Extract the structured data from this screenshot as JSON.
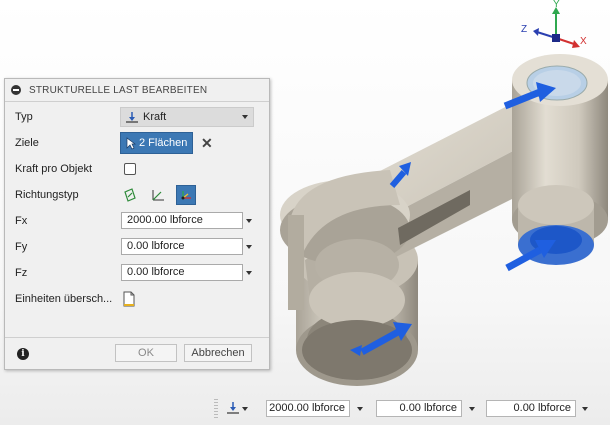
{
  "dialog": {
    "title": "STRUKTURELLE LAST BEARBEITEN",
    "typ_label": "Typ",
    "typ_value": "Kraft",
    "ziele_label": "Ziele",
    "ziele_value": "2 Flächen",
    "kraft_pro_objekt_label": "Kraft pro Objekt",
    "kraft_pro_objekt_checked": false,
    "richtungstyp_label": "Richtungstyp",
    "fx_label": "Fx",
    "fx_value": "2000.00 lbforce",
    "fy_label": "Fy",
    "fy_value": "0.00 lbforce",
    "fz_label": "Fz",
    "fz_value": "0.00 lbforce",
    "einheiten_label": "Einheiten übersch...",
    "ok_label": "OK",
    "cancel_label": "Abbrechen"
  },
  "toolbar": {
    "fx_value": "2000.00 lbforce",
    "fy_value": "0.00 lbforce",
    "fz_value": "0.00 lbforce"
  },
  "viewcube": {
    "x_label": "X",
    "y_label": "Y",
    "z_label": "Z"
  },
  "colors": {
    "accent": "#3c78b4",
    "part": "#d2ccc0",
    "part_dark": "#9e988c",
    "force_arrow": "#1f5fe0",
    "axis_x": "#d23030",
    "axis_y": "#2fa84f",
    "axis_z": "#2a3fb0"
  }
}
